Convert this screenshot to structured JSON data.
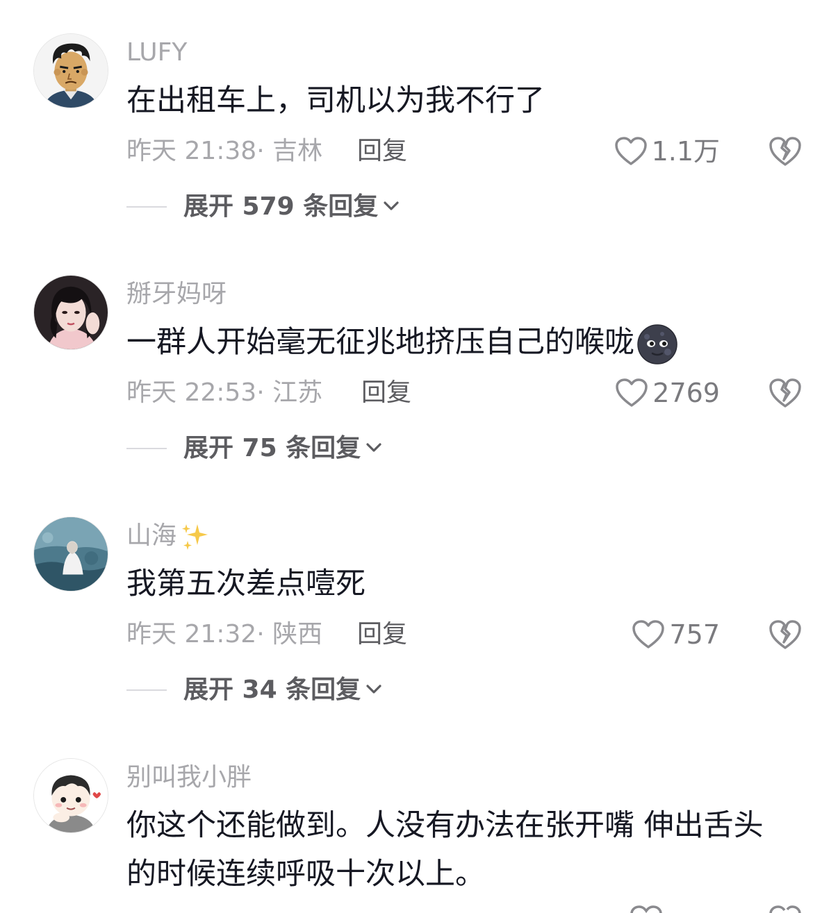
{
  "comments": [
    {
      "username": "LUFY",
      "text": "在出租车上，司机以为我不行了",
      "time": "昨天 21:38",
      "location": "吉林",
      "reply_label": "回复",
      "likes": "1.1万",
      "expand_label": "展开 579 条回复"
    },
    {
      "username": "掰牙妈呀",
      "text": "一群人开始毫无征兆地挤压自己的喉咙",
      "time": "昨天 22:53",
      "location": "江苏",
      "reply_label": "回复",
      "likes": "2769",
      "expand_label": "展开 75 条回复",
      "emoji": "new-moon-face-emoji"
    },
    {
      "username": "山海",
      "username_icon": "sparkles-icon",
      "text": "我第五次差点噎死",
      "time": "昨天 21:32",
      "location": "陕西",
      "reply_label": "回复",
      "likes": "757",
      "expand_label": "展开 34 条回复"
    },
    {
      "username": "别叫我小胖",
      "text_line1": "你这个还能做到。人没有办法在张开嘴 伸出舌头",
      "text_line2": "的时候连续呼吸十次以上。"
    }
  ],
  "separator": "·",
  "colors": {
    "text_primary": "#161823",
    "text_secondary": "#a7a7ab",
    "action_text": "#5c5c60",
    "divider": "#dadade"
  }
}
